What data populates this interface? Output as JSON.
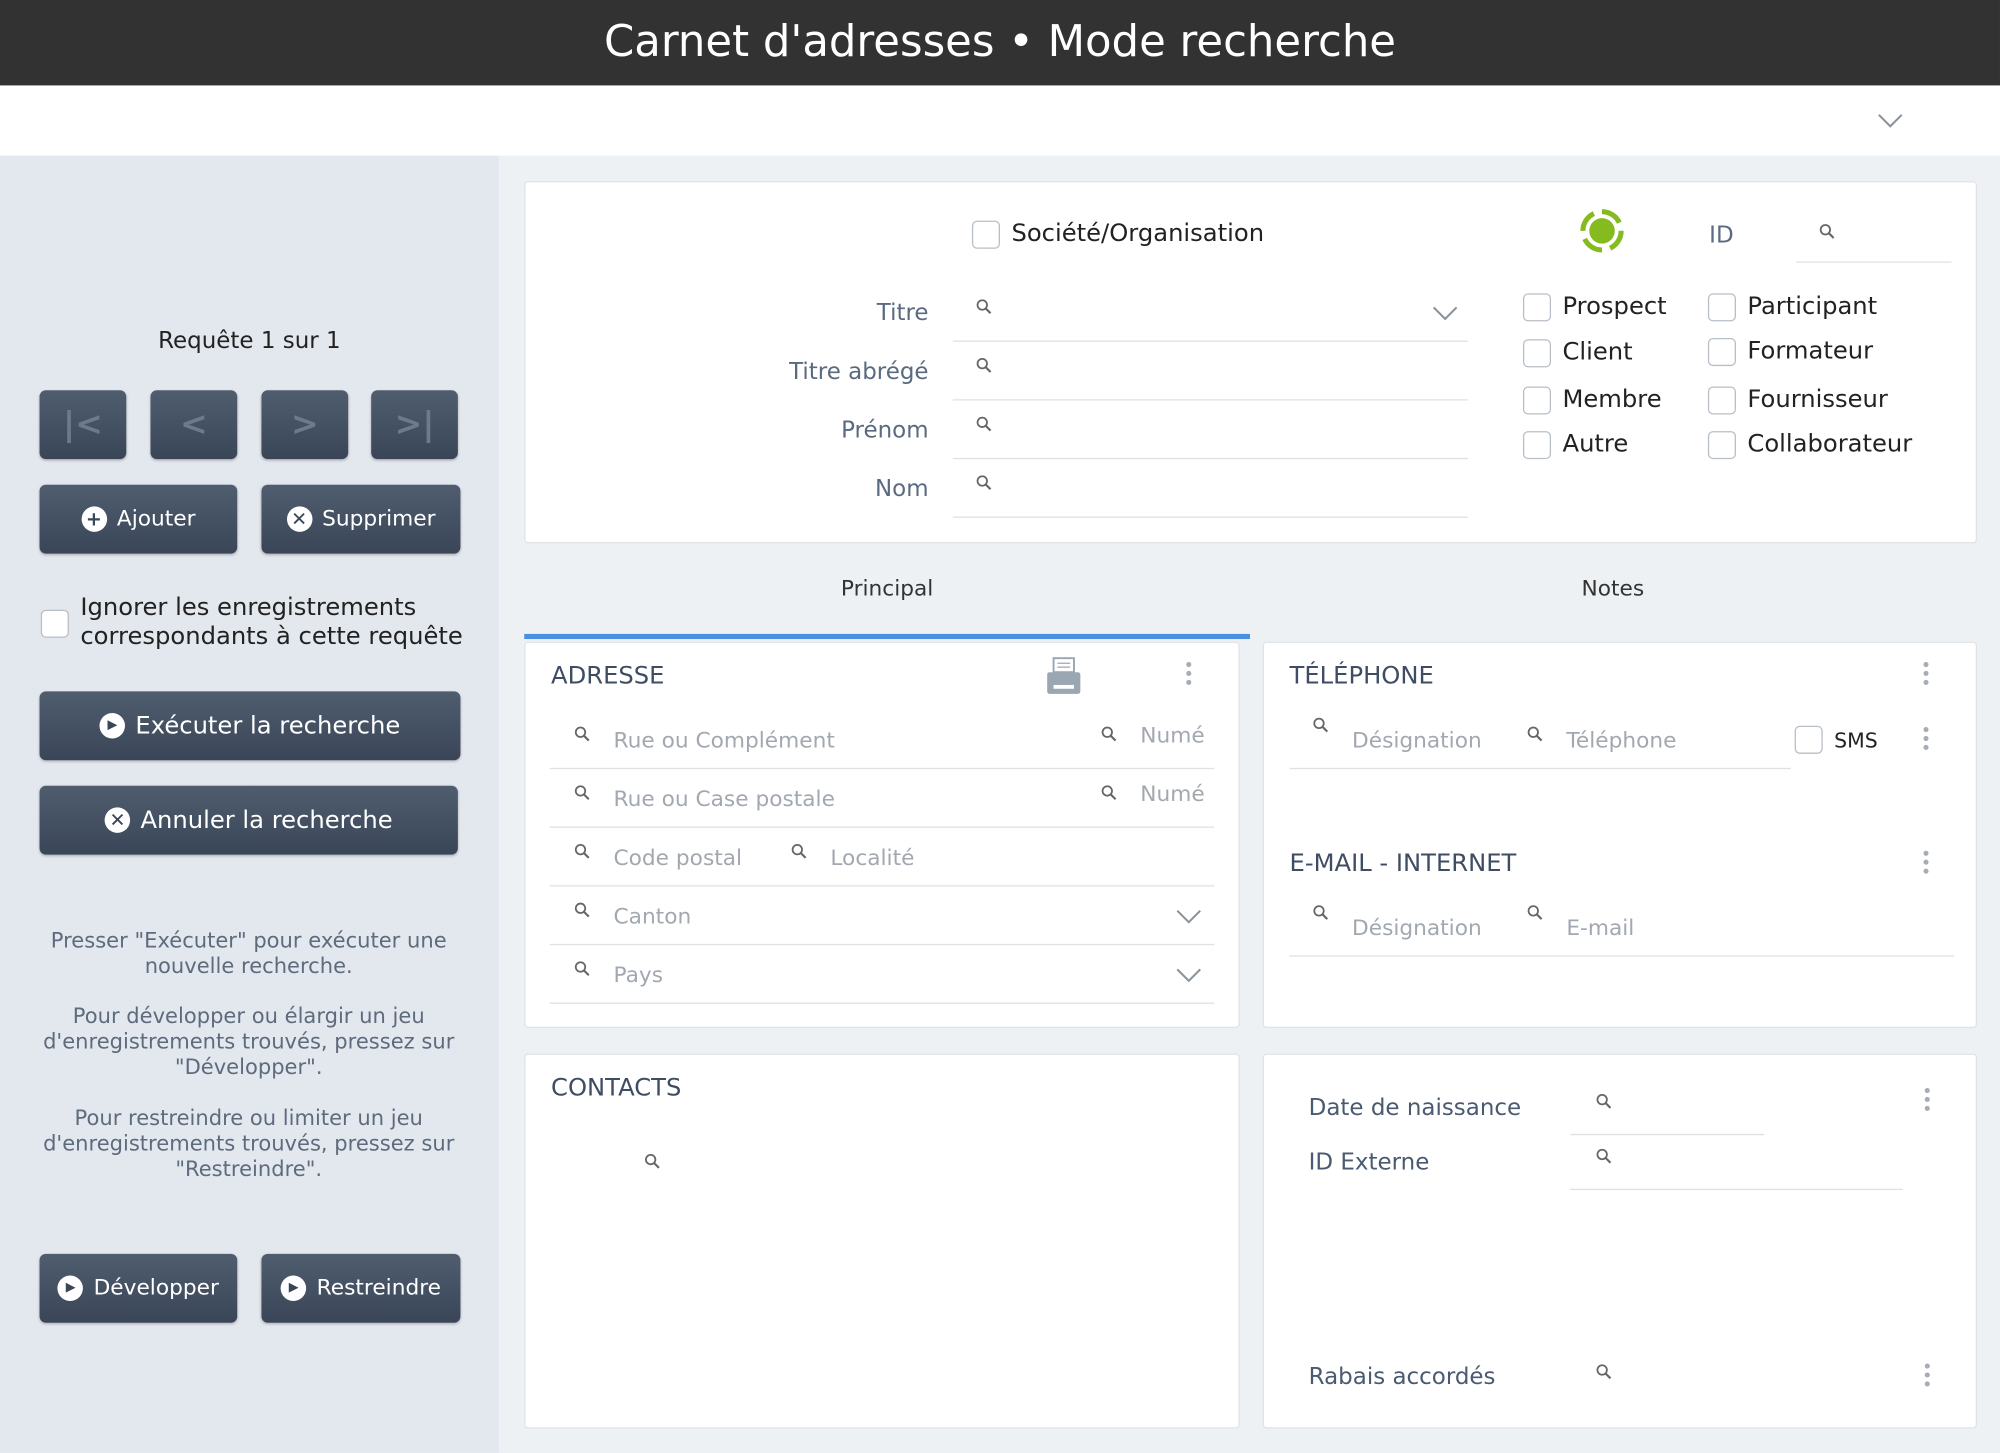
{
  "window": {
    "title": "Carnet d'adresses • Mode recherche"
  },
  "sidebar": {
    "request_label": "Requête 1 sur 1",
    "nav": [
      "first",
      "previous",
      "next",
      "last"
    ],
    "add_label": "Ajouter",
    "delete_label": "Supprimer",
    "ignore_label_line1": "Ignorer les enregistrements",
    "ignore_label_line2": "correspondants à cette requête",
    "ignore_checked": false,
    "execute_label": "Exécuter la recherche",
    "cancel_label": "Annuler la recherche",
    "help": [
      [
        "Presser \"Exécuter\" pour exécuter une",
        "nouvelle recherche."
      ],
      [
        "Pour développer ou élargir un jeu",
        "d'enregistrements trouvés, pressez sur",
        "\"Développer\"."
      ],
      [
        "Pour restreindre ou limiter un jeu",
        "d'enregistrements trouvés, pressez sur",
        "\"Restreindre\"."
      ]
    ],
    "expand_label": "Développer",
    "restrict_label": "Restreindre"
  },
  "header": {
    "organization_label": "Société/Organisation",
    "organization_checked": false,
    "status_color": "#86bb1f",
    "id_label": "ID",
    "id_value": "",
    "fields": [
      {
        "label": "Titre",
        "value": "",
        "dropdown": true
      },
      {
        "label": "Titre abrégé",
        "value": ""
      },
      {
        "label": "Prénom",
        "value": ""
      },
      {
        "label": "Nom",
        "value": ""
      }
    ],
    "categories": [
      {
        "label": "Prospect",
        "checked": false
      },
      {
        "label": "Participant",
        "checked": false
      },
      {
        "label": "Client",
        "checked": false
      },
      {
        "label": "Formateur",
        "checked": false
      },
      {
        "label": "Membre",
        "checked": false
      },
      {
        "label": "Fournisseur",
        "checked": false
      },
      {
        "label": "Autre",
        "checked": false
      },
      {
        "label": "Collaborateur",
        "checked": false
      }
    ]
  },
  "tabs": [
    {
      "label": "Principal",
      "active": true
    },
    {
      "label": "Notes",
      "active": false
    }
  ],
  "accent_color": "#4a90e2",
  "address": {
    "title": "ADRESSE",
    "street1_placeholder": "Rue ou Complément",
    "number1_placeholder": "Numé",
    "street2_placeholder": "Rue ou Case postale",
    "number2_placeholder": "Numé",
    "zip_placeholder": "Code postal",
    "city_placeholder": "Localité",
    "canton_placeholder": "Canton",
    "country_placeholder": "Pays"
  },
  "phone": {
    "title": "TÉLÉPHONE",
    "designation_placeholder": "Désignation",
    "phone_placeholder": "Téléphone",
    "sms_label": "SMS",
    "sms_checked": false
  },
  "email": {
    "title": "E-MAIL - INTERNET",
    "designation_placeholder": "Désignation",
    "email_placeholder": "E-mail"
  },
  "contacts": {
    "title": "CONTACTS"
  },
  "details": {
    "birthdate_label": "Date de naissance",
    "external_id_label": "ID Externe",
    "discounts_label": "Rabais accordés"
  }
}
